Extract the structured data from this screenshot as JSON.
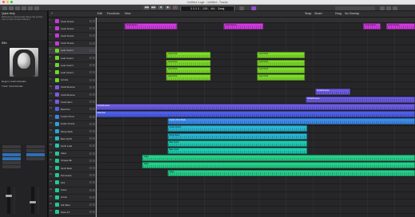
{
  "window": {
    "title": "Untitled Logic - Untitled - Tracks",
    "traffic_colors": [
      "#ff5f57",
      "#febc2e",
      "#28c840"
    ]
  },
  "toolbar": {
    "lcd_position": "1 1 1 1",
    "lcd_tempo": "120",
    "lcd_signature": "4/4",
    "lcd_key": "Cmaj"
  },
  "menu": {
    "edit": "Edit",
    "functions": "Functions",
    "view": "View",
    "snap": "Snap",
    "snap_value": "Smart",
    "drag_label": "Drag",
    "drag_value": "No Overlap"
  },
  "quick_help": {
    "title": "Quick Help",
    "body": "Welcome to Quick Help! Move the pointer over an item to learn about it."
  },
  "inspector": {
    "region_label": "Region: Audio Defaults",
    "track_label": "Track: Vocal Double",
    "artist": "Billie"
  },
  "tracks": [
    {
      "name": "Vocal Texture",
      "color": "#c43ad8"
    },
    {
      "name": "Vocal Texture",
      "color": "#c43ad8"
    },
    {
      "name": "Vocal Texture",
      "color": "#c43ad8"
    },
    {
      "name": "Vocal Texture",
      "color": "#c43ad8"
    },
    {
      "name": "Lead Vocal 1",
      "color": "#6bd82a"
    },
    {
      "name": "Lead Vocal 2",
      "color": "#6bd82a"
    },
    {
      "name": "Lead Vocal 3",
      "color": "#6bd82a"
    },
    {
      "name": "Lead Vocal 4",
      "color": "#6bd82a"
    },
    {
      "name": "Ad Libs",
      "color": "#6bd82a"
    },
    {
      "name": "Vocal Reverse",
      "color": "#7b5be0"
    },
    {
      "name": "Vocal Reverse",
      "color": "#7b5be0"
    },
    {
      "name": "Vocal Harm",
      "color": "#7b5be0"
    },
    {
      "name": "Beat Pad",
      "color": "#4a64e6"
    },
    {
      "name": "Custom Drum",
      "color": "#3d85e8"
    },
    {
      "name": "Guitar Chords",
      "color": "#2aa3d8"
    },
    {
      "name": "String Stack",
      "color": "#2aa3d8"
    },
    {
      "name": "Bass Synth",
      "color": "#22b8c8"
    },
    {
      "name": "Synth Lead",
      "color": "#22c8a8"
    },
    {
      "name": "Claps",
      "color": "#22c894"
    },
    {
      "name": "Vintage Mk",
      "color": "#22c894"
    },
    {
      "name": "Synth Bells",
      "color": "#22c894"
    },
    {
      "name": "Percussion",
      "color": "#22c894"
    },
    {
      "name": "Kick",
      "color": "#22c894"
    },
    {
      "name": "Snare",
      "color": "#22c894"
    },
    {
      "name": "Hi Hat",
      "color": "#22c894"
    },
    {
      "name": "Sub Bass",
      "color": "#22c894"
    },
    {
      "name": "Noise FX",
      "color": "#22c894"
    }
  ],
  "regions": {
    "vocal_texture_a": "Vocal Texture",
    "vocal_texture_b": "Vocal Texture",
    "lead_vocal": "Lead Vocal",
    "vocal_reverse": "Vocal Reverse",
    "beat_pad": "Beat Pad",
    "custom_drum": "Custom Drum Beat",
    "guitar": "Guitar Chords",
    "strings": "String Stack",
    "bass": "Bass Synth",
    "claps": "Claps"
  },
  "colors": {
    "magenta": "#d23be0",
    "green": "#7ddb2c",
    "purple": "#6b5be0",
    "indigo": "#4d5ee8",
    "blue": "#3d8ae8",
    "cyan": "#27b7d4",
    "teal": "#1fc9b0",
    "mint": "#26cf8a"
  }
}
